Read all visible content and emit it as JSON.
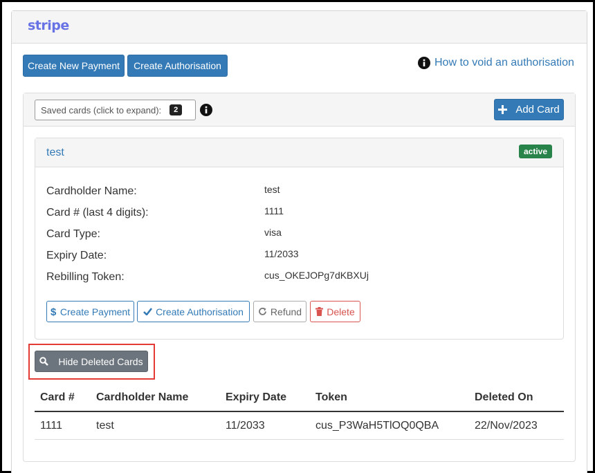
{
  "brand": {
    "logo_text": "stripe"
  },
  "toolbar": {
    "create_payment_label": "Create New Payment",
    "create_authorisation_label": "Create Authorisation",
    "help_link_label": "How to void an authorisation"
  },
  "saved_cards": {
    "label": "Saved cards (click to expand):",
    "count": "2",
    "add_card_label": "Add Card"
  },
  "card": {
    "name": "test",
    "status": "active",
    "fields": [
      {
        "label": "Cardholder Name:",
        "value": "test"
      },
      {
        "label": "Card # (last 4 digits):",
        "value": "1111"
      },
      {
        "label": "Card Type:",
        "value": "visa"
      },
      {
        "label": "Expiry Date:",
        "value": "11/2033"
      },
      {
        "label": "Rebilling Token:",
        "value": "cus_OKEJOPg7dKBXUj"
      }
    ],
    "actions": {
      "create_payment": "Create Payment",
      "create_authorisation": "Create Authorisation",
      "refund": "Refund",
      "delete": "Delete"
    }
  },
  "deleted_cards": {
    "toggle_label": "Hide Deleted Cards",
    "columns": [
      "Card #",
      "Cardholder Name",
      "Expiry Date",
      "Token",
      "Deleted On"
    ],
    "rows": [
      [
        "1111",
        "test",
        "11/2033",
        "cus_P3WaH5TlOQ0QBA",
        "22/Nov/2023"
      ]
    ]
  },
  "colors": {
    "primary": "#337ab7",
    "brand": "#6772e5",
    "success": "#28834a",
    "danger": "#d9534f",
    "highlight": "#e53935"
  },
  "icons": [
    "info-icon",
    "plus-icon",
    "dollar-icon",
    "check-icon",
    "refresh-icon",
    "trash-icon",
    "search-icon"
  ]
}
